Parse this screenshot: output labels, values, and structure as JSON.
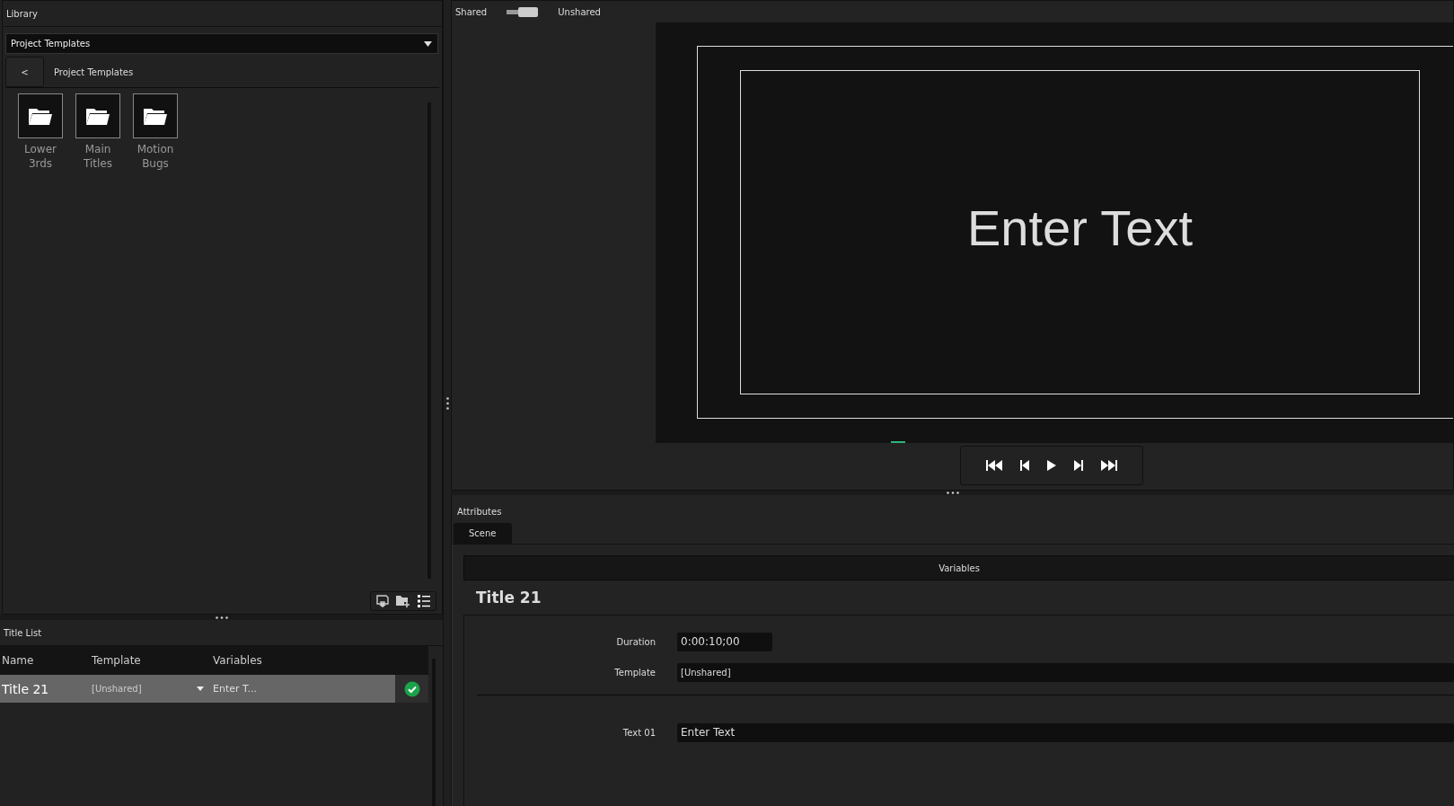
{
  "library": {
    "title": "Library",
    "dropdown": "Project Templates",
    "back": "<",
    "breadcrumb": "Project Templates",
    "folders": [
      {
        "label": "Lower\n3rds"
      },
      {
        "label": "Main\nTitles"
      },
      {
        "label": "Motion\nBugs"
      }
    ]
  },
  "title_list": {
    "title": "Title List",
    "columns": [
      "Name",
      "Template",
      "Variables"
    ],
    "rows": [
      {
        "name": "Title 21",
        "template": "[Unshared]",
        "variables": "Enter T...",
        "selected": true,
        "ok": true
      }
    ]
  },
  "viewer": {
    "switch": {
      "left_label": "Shared",
      "right_label": "Unshared",
      "on": true
    },
    "preview_text": "Enter Text"
  },
  "attributes": {
    "title": "Attributes",
    "tabs": [
      {
        "label": "Scene",
        "selected": true
      }
    ],
    "section": "Variables",
    "heading": "Title 21",
    "fields": [
      {
        "label": "Duration",
        "value": "0:00:10;00",
        "kind": "short"
      },
      {
        "label": "Template",
        "value": "[Unshared]",
        "kind": "wide"
      },
      {
        "label": "Text 01",
        "value": "Enter Text",
        "kind": "text"
      }
    ]
  }
}
